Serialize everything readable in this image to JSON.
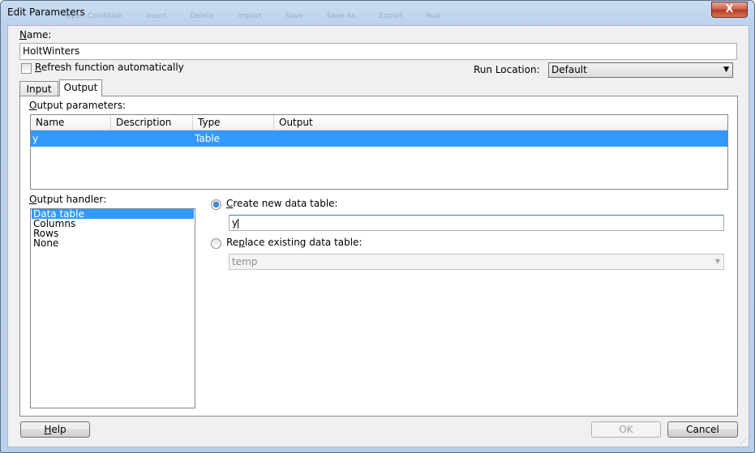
{
  "window": {
    "title": "Edit Parameters",
    "close_glyph": "X"
  },
  "ghost_toolbar": [
    "Open Condition",
    "Insert",
    "Delete",
    "Import",
    "Save",
    "Save As",
    "Export",
    "Run"
  ],
  "name": {
    "label_mnemonic": "N",
    "label_rest": "ame:",
    "value": "HoltWinters"
  },
  "refresh": {
    "label_mnemonic": "R",
    "label_rest": "efresh function automatically",
    "checked": false
  },
  "run_location": {
    "label": "Run Location:",
    "value": "Default"
  },
  "tabs": [
    {
      "label": "Input"
    },
    {
      "label": "Output",
      "active": true
    }
  ],
  "output_parameters": {
    "label_mnemonic": "O",
    "label_rest": "utput parameters:",
    "columns": [
      "Name",
      "Description",
      "Type",
      "Output"
    ],
    "rows": [
      {
        "name": "y",
        "description": "",
        "type": "Table",
        "output": ""
      }
    ]
  },
  "output_handler": {
    "label_mnemonic": "O",
    "label_rest": "utput handler:",
    "items": [
      "Data table",
      "Columns",
      "Rows",
      "None"
    ],
    "selected": "Data table"
  },
  "create_new": {
    "label_mnemonic": "C",
    "label_rest": "reate new data table:",
    "selected": true,
    "value": "y"
  },
  "replace_existing": {
    "label_pre": "Re",
    "label_mnemonic": "p",
    "label_rest": "lace existing data table:",
    "selected": false,
    "value": "temp"
  },
  "buttons": {
    "help_mnemonic": "H",
    "help_rest": "elp",
    "ok": "OK",
    "cancel": "Cancel"
  },
  "colors": {
    "selection": "#3399ff",
    "titlebar": "#bcd2ec",
    "close": "#c75a45"
  }
}
